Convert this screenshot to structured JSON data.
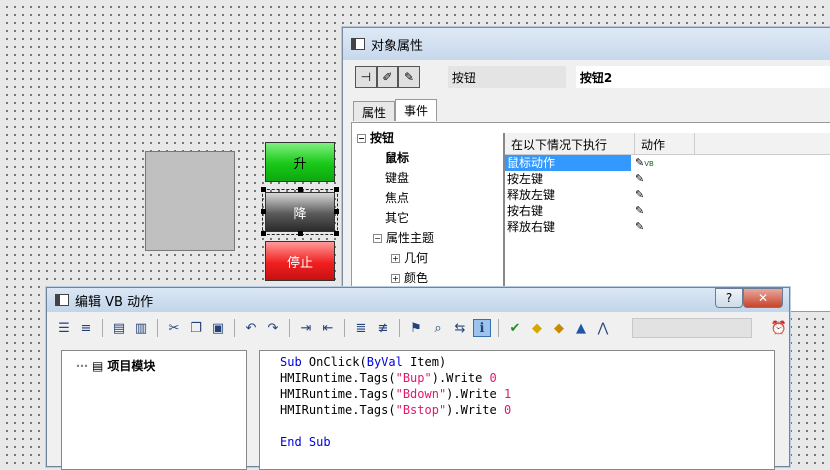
{
  "canvas": {
    "buttons": {
      "up": "升",
      "down": "降",
      "stop": "停止"
    }
  },
  "props_window": {
    "title": "对象属性",
    "type_label": "按钮",
    "object_name": "按钮2",
    "tabs": [
      "属性",
      "事件"
    ],
    "tree": [
      {
        "label": "按钮",
        "expander": "−",
        "bold": true
      },
      {
        "label": "鼠标",
        "bold": true
      },
      {
        "label": "键盘"
      },
      {
        "label": "焦点"
      },
      {
        "label": "其它"
      },
      {
        "label": "属性主题",
        "expander": "−"
      },
      {
        "label": "几何",
        "expander": "+"
      },
      {
        "label": "颜色",
        "expander": "+"
      }
    ],
    "grid_headers": [
      "在以下情况下执行",
      "动作"
    ],
    "grid_rows": [
      "鼠标动作",
      "按左键",
      "释放左键",
      "按右键",
      "释放右键"
    ],
    "vb_badge": "VB"
  },
  "vb_window": {
    "title": "编辑 VB 动作",
    "help": "?",
    "close": "✕",
    "module": "项目模块",
    "code": [
      [
        {
          "t": "Sub",
          "c": "kw"
        },
        {
          "t": " OnClick("
        },
        {
          "t": "ByVal",
          "c": "kw"
        },
        {
          "t": " Item)"
        }
      ],
      [
        {
          "t": "HMIRuntime.Tags("
        },
        {
          "t": "\"Bup\"",
          "c": "str"
        },
        {
          "t": ").Write "
        },
        {
          "t": "0",
          "c": "num"
        }
      ],
      [
        {
          "t": "HMIRuntime.Tags("
        },
        {
          "t": "\"Bdown\"",
          "c": "str"
        },
        {
          "t": ").Write "
        },
        {
          "t": "1",
          "c": "num"
        }
      ],
      [
        {
          "t": "HMIRuntime.Tags("
        },
        {
          "t": "\"Bstop\"",
          "c": "str"
        },
        {
          "t": ").Write "
        },
        {
          "t": "0",
          "c": "num"
        }
      ],
      [],
      [
        {
          "t": "End Sub",
          "c": "kw"
        }
      ]
    ]
  }
}
